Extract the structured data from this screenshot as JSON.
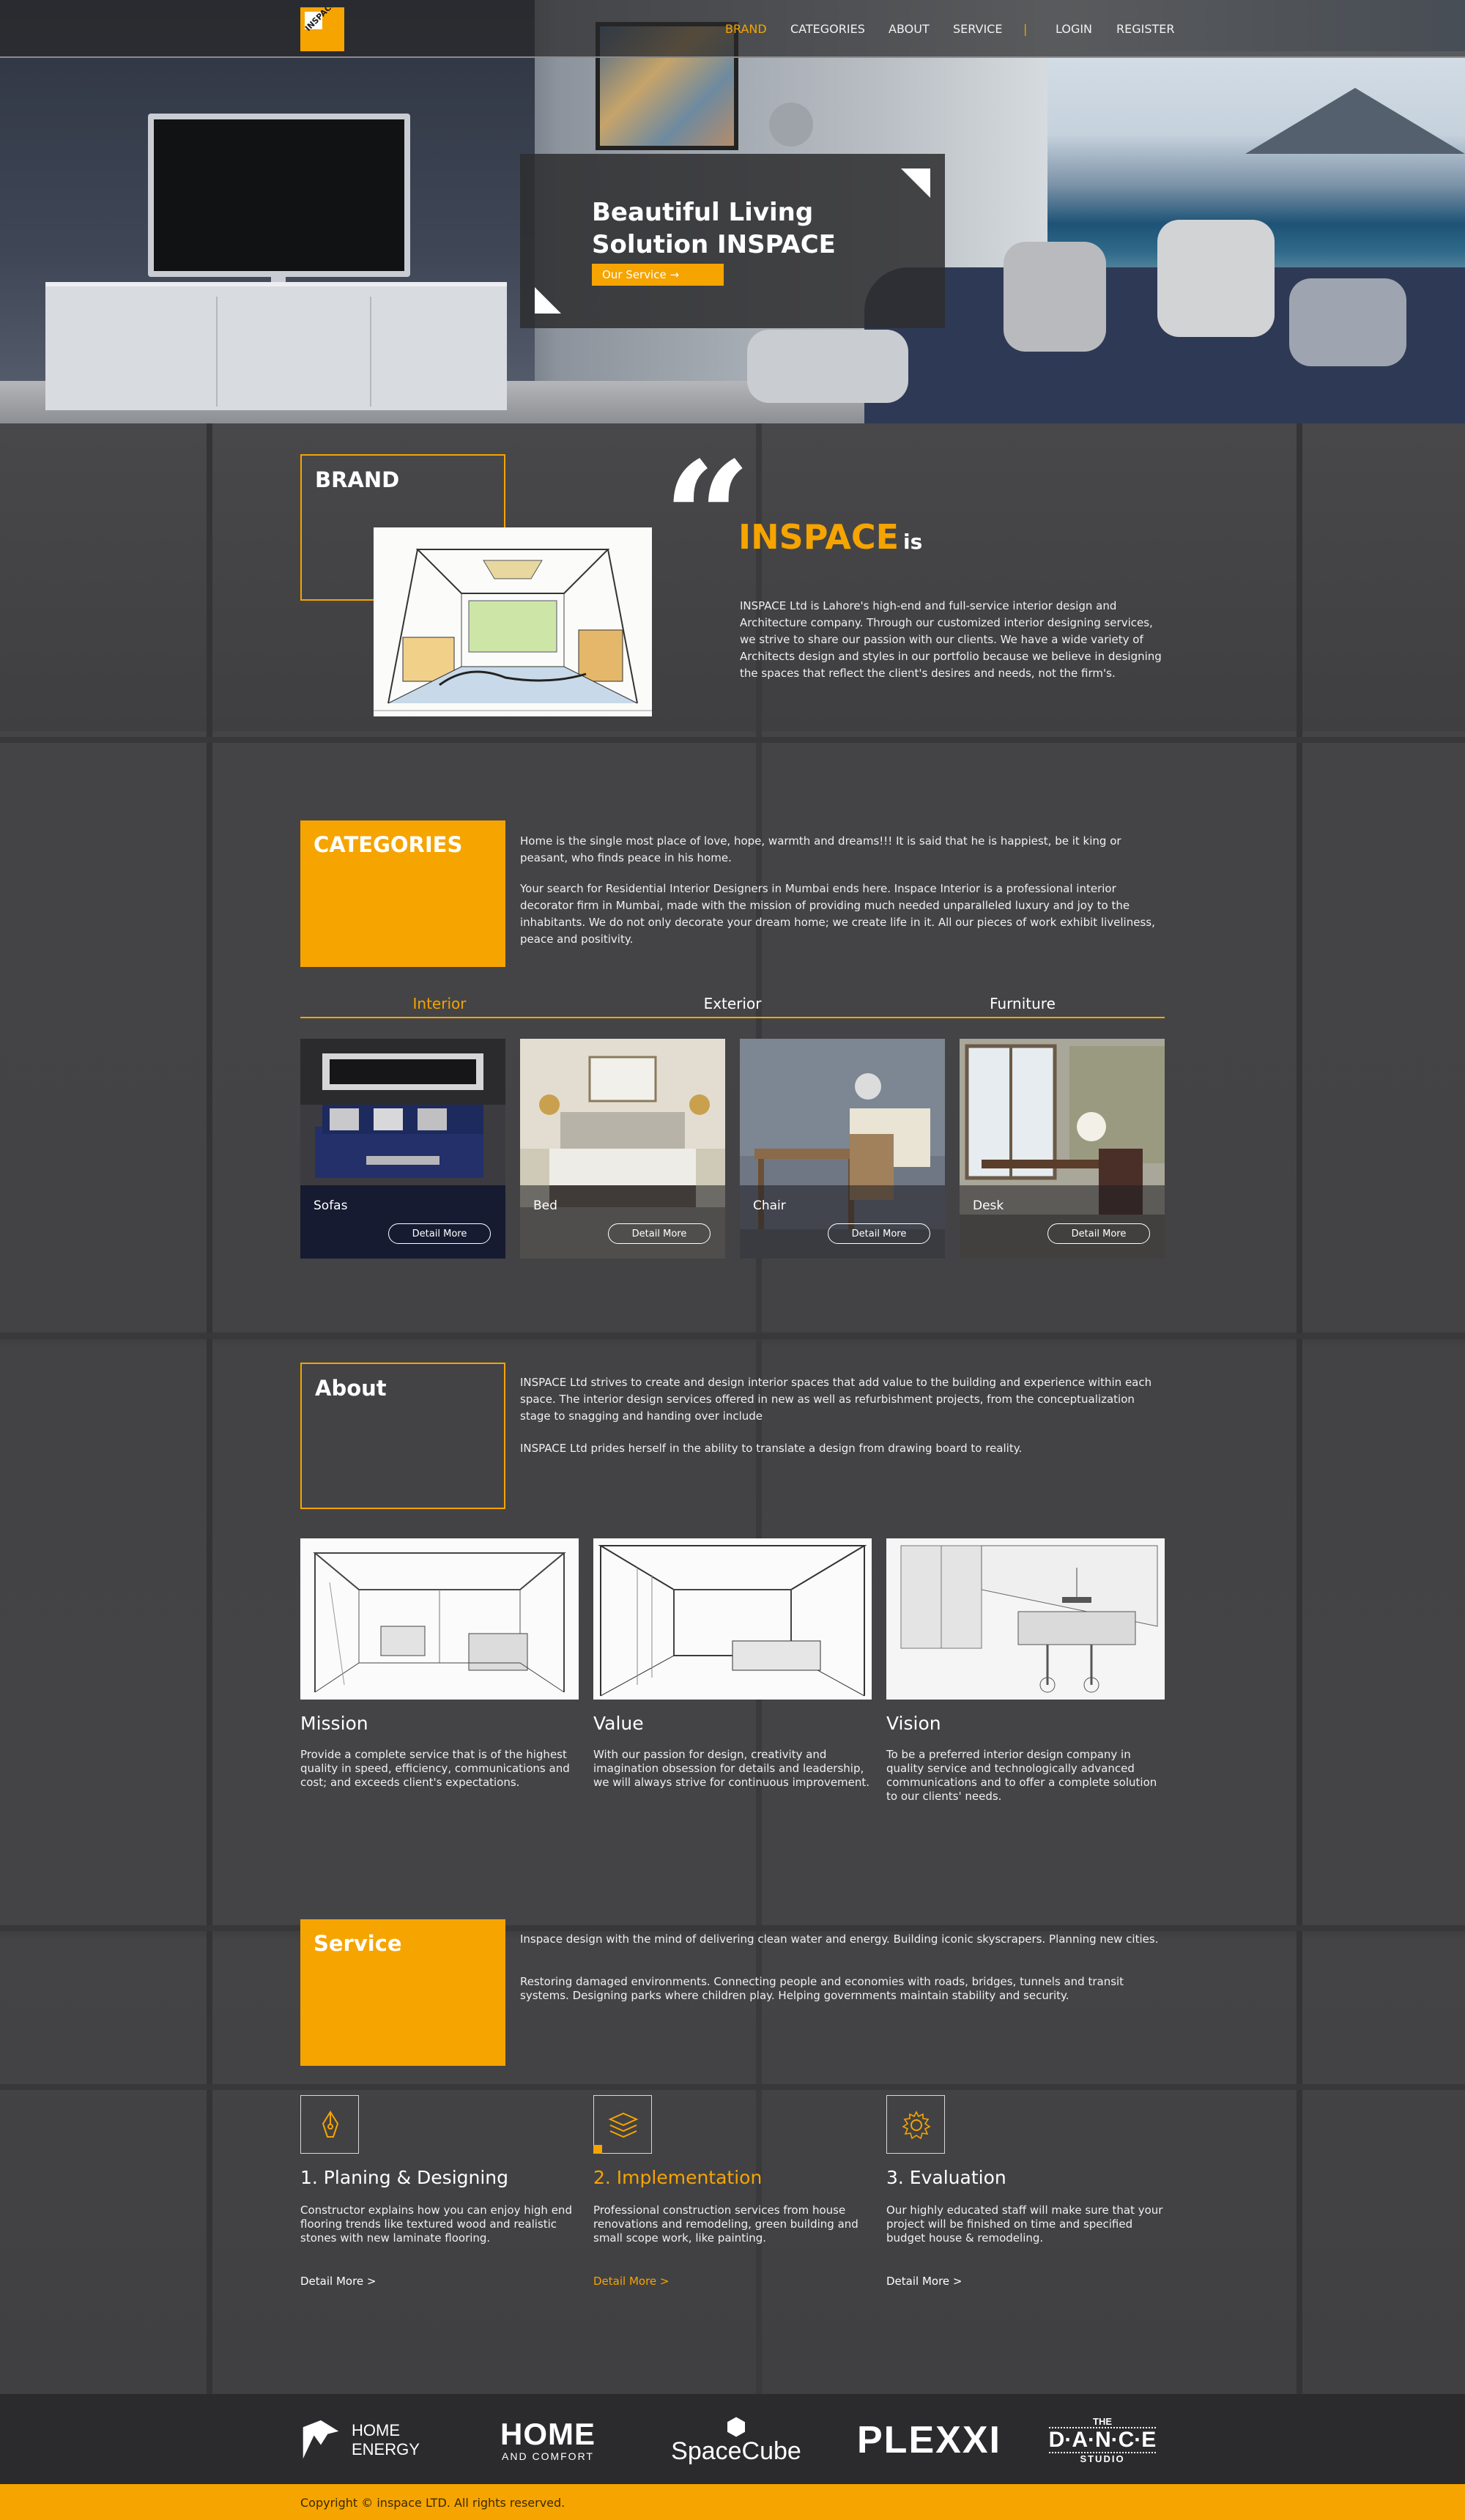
{
  "nav": {
    "logo_text": "INSPACE",
    "items": [
      "BRAND",
      "CATEGORIES",
      "ABOUT",
      "SERVICE",
      "|",
      "LOGIN",
      "REGISTER"
    ]
  },
  "hero": {
    "title_line1": "Beautiful Living",
    "title_line2": "Solution INSPACE",
    "button": "Our Service →"
  },
  "brand": {
    "label": "BRAND",
    "title": "INSPACE",
    "title_suffix": "is",
    "text": "INSPACE Ltd is Lahore's high-end and full-service interior design and Architecture company. Through our customized interior designing services, we strive to share our passion with our clients. We have a wide variety of Architects design and styles in our portfolio because we believe in designing the spaces that reflect the client's desires and needs, not the firm's."
  },
  "categories": {
    "label": "CATEGORIES",
    "para1": "Home is the single most place of love, hope, warmth and dreams!!! It is said that he is happiest, be it king or peasant, who finds peace in his home.",
    "para2": "Your search for Residential Interior Designers in Mumbai ends here. Inspace Interior is a professional interior decorator firm in Mumbai, made with the mission of providing much needed unparalleled luxury and joy to the inhabitants. We do not only decorate your dream home; we create life in it. All our pieces of work exhibit liveliness, peace and positivity.",
    "tabs": [
      "Interior",
      "Exterior",
      "Furniture"
    ],
    "cards": [
      {
        "name": "Sofas",
        "button": "Detail More"
      },
      {
        "name": "Bed",
        "button": "Detail More"
      },
      {
        "name": "Chair",
        "button": "Detail More"
      },
      {
        "name": "Desk",
        "button": "Detail More"
      }
    ]
  },
  "about": {
    "label": "About",
    "para1": "INSPACE Ltd strives to create and design interior spaces that add value to the building and experience within each space. The interior design services offered in new as well as refurbishment projects, from the conceptualization stage to snagging and handing over include",
    "para2": "INSPACE Ltd prides herself in the ability to translate a design from drawing board to reality.",
    "columns": [
      {
        "title": "Mission",
        "text": "Provide a complete service that is of the highest quality in speed, efficiency, communications and cost; and exceeds client's expectations."
      },
      {
        "title": "Value",
        "text": "With our passion for design, creativity and imagination obsession for details and leadership, we will always strive for continuous improvement."
      },
      {
        "title": "Vision",
        "text": "To be a preferred interior design company in quality service and technologically advanced communications and to offer a complete solution to our clients' needs."
      }
    ]
  },
  "service": {
    "label": "Service",
    "para1": "Inspace design with the mind of delivering clean water and energy. Building iconic skyscrapers. Planning new cities.",
    "para2": "Restoring damaged environments. Connecting people and economies with roads, bridges, tunnels and transit systems. Designing parks where children play. Helping governments maintain stability and security.",
    "items": [
      {
        "icon": "pen-nib-icon",
        "title": "1. Planing & Designing",
        "text": "Constructor explains how you can enjoy high end flooring trends like textured wood and realistic stones with new laminate flooring.",
        "link": "Detail More >"
      },
      {
        "icon": "layers-icon",
        "title": "2. Implementation",
        "text": "Professional construction services from house renovations and remodeling, green building and small scope work, like painting.",
        "link": "Detail More >"
      },
      {
        "icon": "gear-icon",
        "title": "3. Evaluation",
        "text": "Our highly educated staff will make sure that your project will be finished on time and specified budget house & remodeling.",
        "link": "Detail More >"
      }
    ]
  },
  "partners": {
    "p1_line1": "HOME",
    "p1_line2": "ENERGY",
    "p2_line1": "HOME",
    "p2_line2": "AND COMFORT",
    "p3": "SpaceCube",
    "p4": "PLEXXI",
    "p5_line1": "THE",
    "p5_line2": "D·A·N·C·E",
    "p5_line3": "STUDIO"
  },
  "footer": {
    "copyright": "Copyright © inspace LTD. All rights reserved."
  },
  "colors": {
    "accent": "#f6a400",
    "background": "#424244",
    "footer_bg": "#f6a400",
    "partners_bg": "#2b2b2d"
  }
}
